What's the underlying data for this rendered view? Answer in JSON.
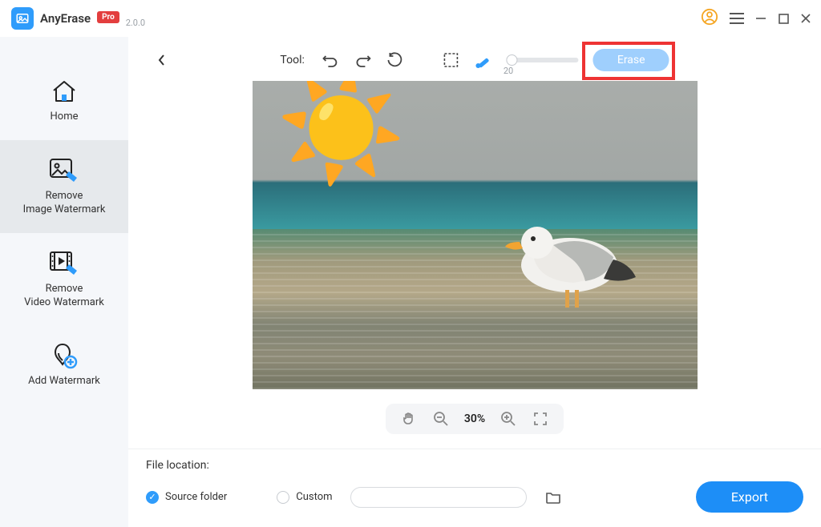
{
  "app": {
    "name": "AnyErase",
    "version": "2.0.0",
    "badge": "Pro"
  },
  "sidebar": {
    "items": [
      {
        "label": "Home"
      },
      {
        "label": "Remove\nImage Watermark"
      },
      {
        "label": "Remove\nVideo Watermark"
      },
      {
        "label": "Add Watermark"
      }
    ]
  },
  "toolbar": {
    "tool_label": "Tool:",
    "brush_size": "20",
    "erase_label": "Erase"
  },
  "zoom": {
    "value": "30%"
  },
  "footer": {
    "location_label": "File location:",
    "option_source": "Source folder",
    "option_custom": "Custom",
    "custom_path": "",
    "export_label": "Export"
  }
}
